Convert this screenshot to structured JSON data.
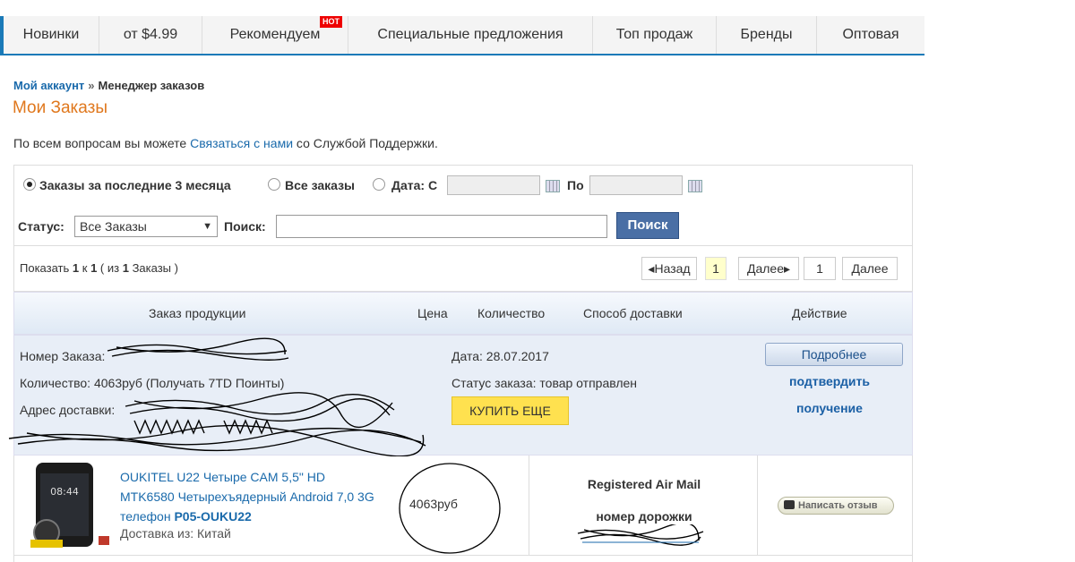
{
  "nav": {
    "items": [
      "Новинки",
      "от $4.99",
      "Рекомендуем",
      "Специальные предложения",
      "Топ продаж",
      "Бренды",
      "Оптовая"
    ],
    "hot_badge": "HOT"
  },
  "breadcrumb": {
    "account": "Мой аккаунт",
    "separator": "»",
    "current": "Менеджер заказов"
  },
  "page_title": "Мои Заказы",
  "support": {
    "prefix": "По всем вопросам вы можете",
    "link": "Связаться с нами",
    "suffix": "со Службой Поддержки."
  },
  "filters": {
    "radio_3months": "Заказы за последние 3 месяца",
    "radio_all": "Все заказы",
    "radio_date": "Дата: С",
    "date_to": "По",
    "status_label": "Статус:",
    "status_value": "Все Заказы",
    "search_label": "Поиск:",
    "search_button": "Поиск"
  },
  "pager": {
    "showing_prefix": "Показать",
    "from": "1",
    "to_word": "к",
    "to": "1",
    "total_prefix": "( из",
    "total": "1",
    "total_suffix": "Заказы )",
    "back": "Назад",
    "current_page": "1",
    "next": "Далее",
    "goto_value": "1",
    "goto_button": "Далее"
  },
  "table_head": {
    "product": "Заказ продукции",
    "price": "Цена",
    "quantity": "Количество",
    "shipping": "Способ доставки",
    "action": "Действие"
  },
  "order": {
    "number_label": "Номер Заказа:",
    "amount": "Количество: 4063руб (Получать 7TD Поинты)",
    "address_label": "Адрес доставки:",
    "date": "Дата: 28.07.2017",
    "status": "Статус заказа: товар отправлен",
    "details_button": "Подробнее",
    "confirm_line1": "подтвердить",
    "confirm_line2": "получение",
    "buy_again": "КУПИТЬ ЕЩЕ"
  },
  "product": {
    "title_line1": "OUKITEL U22 Четыре CAM 5,5\" HD",
    "title_line2": "MTK6580 Четырехъядерный Android 7,0 3G",
    "title_line3": "телефон",
    "sku": "P05-OUKU22",
    "ship_from": "Доставка из: Китай",
    "phone_time": "08:44",
    "price": "4063руб",
    "shipping_method": "Registered Air Mail",
    "tracking_label": "номер дорожки",
    "review_button": "Написать отзыв"
  },
  "colors": {
    "nav_accent": "#1a7ab8",
    "title_orange": "#e0781e",
    "link_blue": "#1a6aab",
    "search_button": "#4a6fa5",
    "buy_button": "#ffe14f",
    "summary_bg": "#e8eef7"
  }
}
